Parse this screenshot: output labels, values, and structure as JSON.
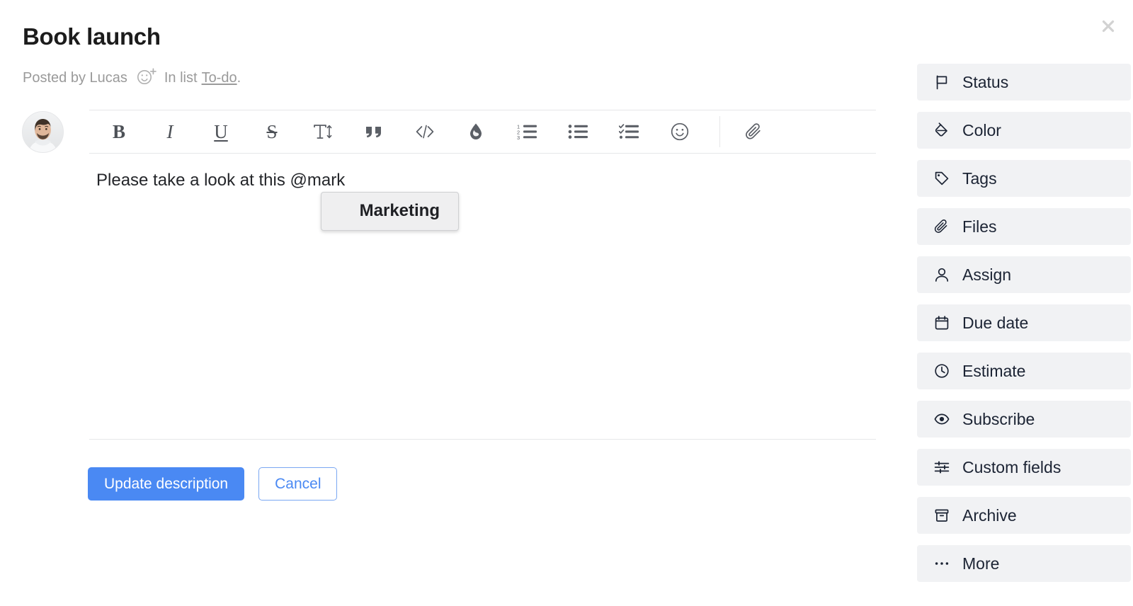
{
  "window": {
    "close_label": "×",
    "close_icon": "close-icon"
  },
  "header": {
    "title": "Book launch",
    "posted_by": "Posted by Lucas",
    "reaction_icon": "add-reaction-icon",
    "in_list_text": "In list",
    "list_name": "To-do",
    "period": "."
  },
  "editor": {
    "avatar_icon": "user-avatar-photo",
    "toolbar": [
      {
        "name": "bold-button",
        "glyph": "B",
        "style": "serif bold"
      },
      {
        "name": "italic-button",
        "glyph": "I",
        "style": "serif ital"
      },
      {
        "name": "underline-button",
        "glyph": "U",
        "style": "serif under"
      },
      {
        "name": "strikethrough-button",
        "glyph": "S",
        "style": "serif strike"
      },
      {
        "name": "text-size-button",
        "icon": "text-size-icon"
      },
      {
        "name": "blockquote-button",
        "icon": "quote-icon"
      },
      {
        "name": "code-button",
        "icon": "code-icon"
      },
      {
        "name": "highlight-button",
        "icon": "droplet-icon"
      },
      {
        "name": "numbered-list-button",
        "icon": "numbered-list-icon"
      },
      {
        "name": "bulleted-list-button",
        "icon": "bulleted-list-icon"
      },
      {
        "name": "checklist-button",
        "icon": "checklist-icon"
      },
      {
        "name": "emoji-button",
        "icon": "smiley-icon"
      },
      {
        "name": "attach-file-button",
        "icon": "paperclip-icon"
      }
    ],
    "body_text": "Please take a look at this @mark",
    "mention_suggestions": [
      "Marketing"
    ]
  },
  "actions": {
    "primary_label": "Update description",
    "secondary_label": "Cancel"
  },
  "sidebar": {
    "items": [
      {
        "label": "Status",
        "icon": "flag-icon"
      },
      {
        "label": "Color",
        "icon": "paint-bucket-icon"
      },
      {
        "label": "Tags",
        "icon": "tag-icon"
      },
      {
        "label": "Files",
        "icon": "paperclip-icon"
      },
      {
        "label": "Assign",
        "icon": "person-icon"
      },
      {
        "label": "Due date",
        "icon": "calendar-icon"
      },
      {
        "label": "Estimate",
        "icon": "clock-icon"
      },
      {
        "label": "Subscribe",
        "icon": "eye-icon"
      },
      {
        "label": "Custom fields",
        "icon": "sliders-icon"
      },
      {
        "label": "Archive",
        "icon": "archive-box-icon"
      },
      {
        "label": "More",
        "icon": "ellipsis-icon"
      }
    ]
  },
  "colors": {
    "accent": "#4a89f3",
    "sidebar_panel": "#f1f2f4",
    "text_primary": "#24262a",
    "text_muted": "#9a9a9a",
    "icon_navy": "#1c2434"
  }
}
